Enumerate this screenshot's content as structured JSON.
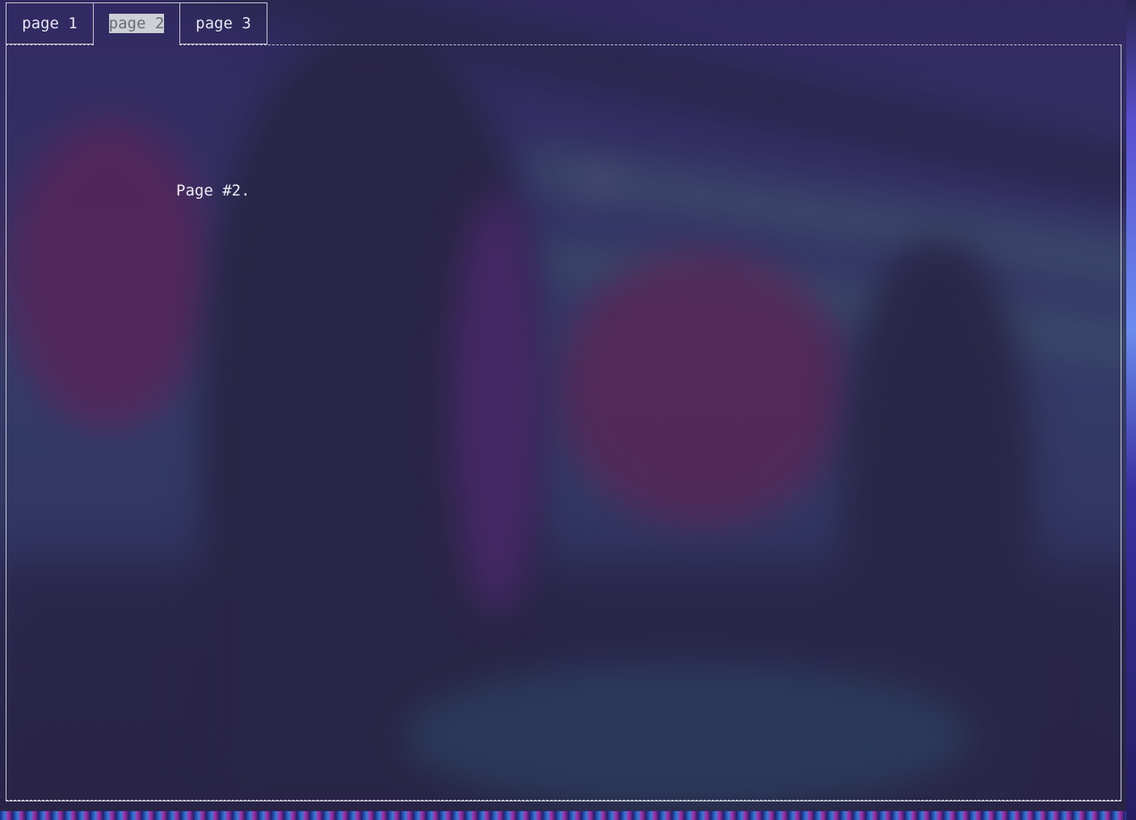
{
  "tabs": [
    {
      "label": "page 1"
    },
    {
      "label": "page 2"
    },
    {
      "label": "page 3"
    }
  ],
  "active_tab": "page 2",
  "content": {
    "text": "Page #2."
  }
}
